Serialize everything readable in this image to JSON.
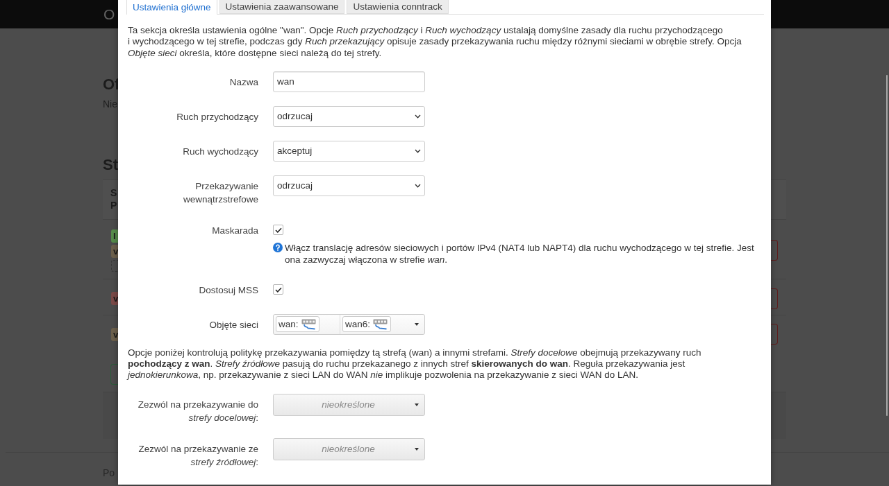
{
  "page": {
    "header": {
      "brand": "O"
    },
    "sections": [
      {
        "heading": "Of",
        "text": "Nie"
      },
      {
        "heading": "St"
      }
    ],
    "table": {
      "header": [
        "S",
        "P"
      ],
      "rows": [
        {
          "badges": [
            {
              "kind": "solid",
              "label": "l",
              "color": "#568c4a"
            },
            {
              "kind": "solid",
              "label": "v",
              "color": "#6c604c"
            },
            {
              "kind": "dashed"
            }
          ]
        },
        {
          "badges": [
            {
              "kind": "solid",
              "label": "v",
              "color": "#7b4a48"
            }
          ]
        },
        {
          "badges": [
            {
              "kind": "solid",
              "label": "v",
              "color": "#6c604c"
            }
          ]
        }
      ]
    },
    "footer": "Po"
  },
  "dialog": {
    "tabs": [
      {
        "label": "Ustawienia główne",
        "selected": true
      },
      {
        "label": "Ustawienia zaawansowane",
        "selected": false
      },
      {
        "label": "Ustawienia conntrack",
        "selected": false
      }
    ],
    "intro": "Ta sekcja określa ustawienia ogólne \"wan\". Opcje *Ruch przychodzący* i *Ruch wychodzący* ustalają domyślne zasady dla ruchu przychodzącego i wychodzącego w tej strefie, podczas gdy *Ruch przekazujący* opisuje zasady przekazywania ruchu między różnymi sieciami w obrębie strefy. Opcja *Objęte sieci* określa, które dostępne sieci należą do tej strefy.",
    "fields": [
      {
        "kind": "text",
        "label": "Nazwa",
        "value": "wan"
      },
      {
        "kind": "select",
        "label": "Ruch przychodzący",
        "value": "odrzucaj"
      },
      {
        "kind": "select",
        "label": "Ruch wychodzący",
        "value": "akceptuj"
      },
      {
        "kind": "select",
        "label": "Przekazywanie wewnątrzstrefowe",
        "value": "odrzucaj"
      },
      {
        "kind": "checkbox",
        "label": "Maskarada",
        "checked": true,
        "help": "Włącz translację adresów sieciowych i portów IPv4 (NAT4 lub NAPT4) dla ruchu wychodzącego w tej strefie. Jest ona zazwyczaj włączona w strefie *wan*."
      },
      {
        "kind": "checkbox",
        "label": "Dostosuj MSS",
        "checked": true
      },
      {
        "kind": "networks",
        "label": "Objęte sieci",
        "networks": [
          "wan:",
          "wan6:"
        ]
      }
    ],
    "forwarding_note": "Opcje poniżej kontrolują politykę przekazywania pomiędzy tą strefą (wan) a innymi strefami. *Strefy docelowe* obejmują przekazywany ruch **pochodzący z wan**. *Strefy źródłowe* pasują do ruchu przekazanego z innych stref **skierowanych do wan**. Reguła przekazywania jest *jednokierunkowa*, np. przekazywanie z sieci LAN do WAN *nie* implikuje pozwolenia na przekazywanie z sieci WAN do LAN.",
    "forwarding_fields": [
      {
        "kind": "dropdown",
        "label": "Zezwól na przekazywanie do *strefy docelowej*:",
        "placeholder": "nieokreślone"
      },
      {
        "kind": "dropdown",
        "label": "Zezwól na przekazywanie ze *strefy źródłowej*:",
        "placeholder": "nieokreślone"
      }
    ]
  }
}
